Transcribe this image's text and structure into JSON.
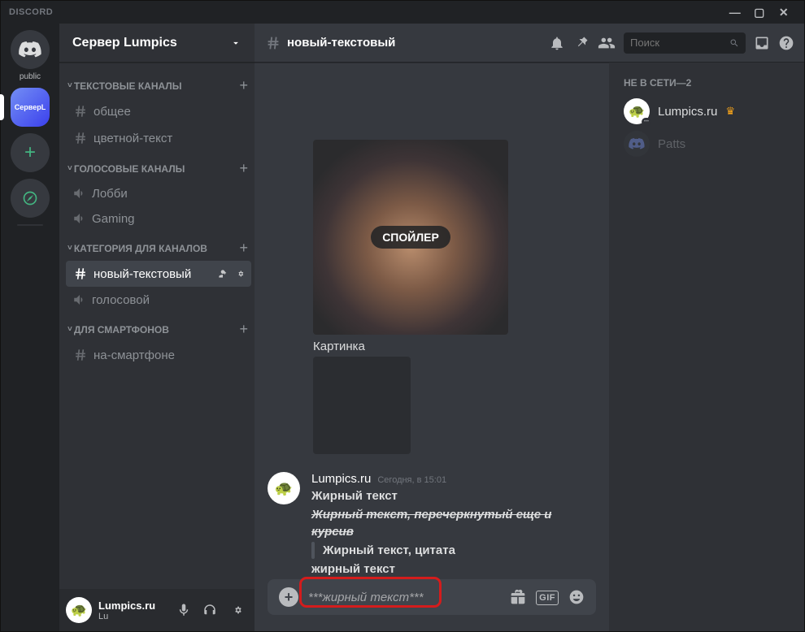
{
  "titlebar": {
    "brand": "DISCORD"
  },
  "guilds": {
    "home_label": "public",
    "selected_name": "СерверL"
  },
  "server": {
    "name": "Сервер Lumpics"
  },
  "categories": [
    {
      "name": "ТЕКСТОВЫЕ КАНАЛЫ",
      "channels": [
        {
          "name": "общее",
          "type": "text"
        },
        {
          "name": "цветной-текст",
          "type": "text"
        }
      ]
    },
    {
      "name": "ГОЛОСОВЫЕ КАНАЛЫ",
      "channels": [
        {
          "name": "Лобби",
          "type": "voice"
        },
        {
          "name": "Gaming",
          "type": "voice"
        }
      ]
    },
    {
      "name": "КАТЕГОРИЯ ДЛЯ КАНАЛОВ",
      "channels": [
        {
          "name": "новый-текстовый",
          "type": "text",
          "selected": true
        },
        {
          "name": "голосовой",
          "type": "voice"
        }
      ]
    },
    {
      "name": "ДЛЯ СМАРТФОНОВ",
      "channels": [
        {
          "name": "на-смартфоне",
          "type": "text"
        }
      ]
    }
  ],
  "user_panel": {
    "name": "Lumpics.ru",
    "tag": "Lu"
  },
  "header": {
    "channel": "новый-текстовый",
    "search_placeholder": "Поиск"
  },
  "messages": {
    "spoiler_label": "СПОЙЛЕР",
    "caption": "Картинка",
    "msg1": {
      "author": "Lumpics.ru",
      "timestamp": "Сегодня, в 15:01",
      "line1": "Жирный текст",
      "line2": "Жирный текст, перечеркнутый еще и курсив",
      "line3": "Жирный текст, цитата",
      "line4": "жирный текст"
    }
  },
  "input": {
    "value": "***жирный текст***",
    "gif": "GIF"
  },
  "members": {
    "title": "НЕ В СЕТИ—2",
    "items": [
      {
        "name": "Lumpics.ru",
        "owner": true
      },
      {
        "name": "Patts",
        "owner": false
      }
    ]
  }
}
